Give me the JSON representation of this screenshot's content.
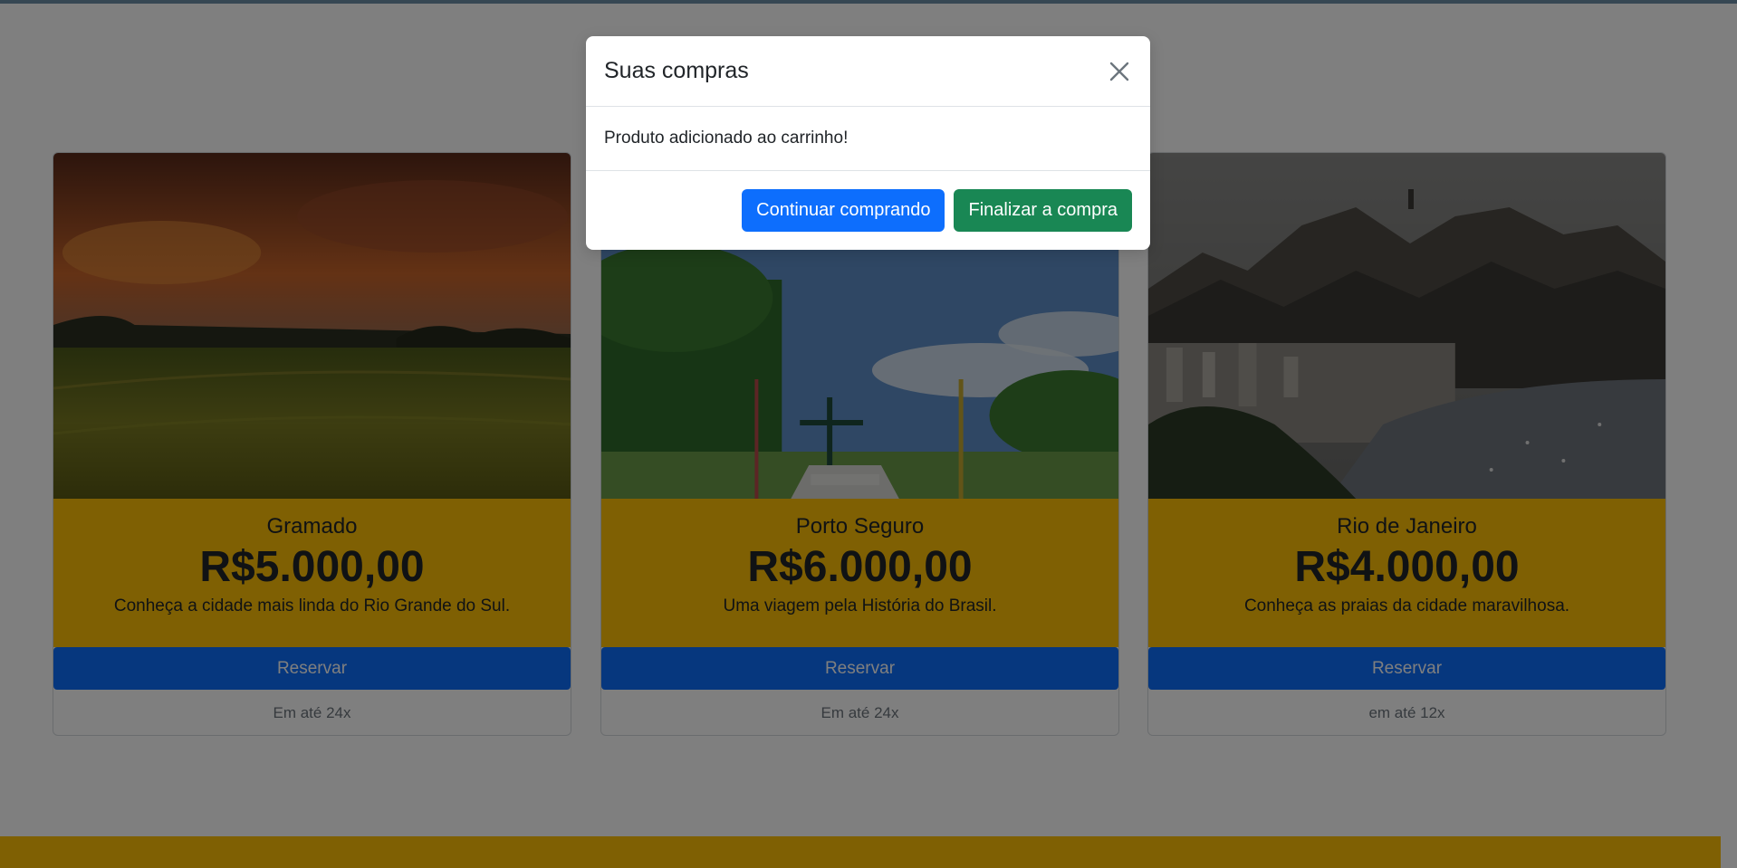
{
  "modal": {
    "title": "Suas compras",
    "message": "Produto adicionado ao carrinho!",
    "continue_label": "Continuar comprando",
    "checkout_label": "Finalizar a compra"
  },
  "cards": [
    {
      "title": "Gramado",
      "price": "R$5.000,00",
      "description": "Conheça a cidade mais linda do Rio Grande do Sul.",
      "button_label": "Reservar",
      "footer": "Em até 24x"
    },
    {
      "title": "Porto Seguro",
      "price": "R$6.000,00",
      "description": "Uma viagem pela História do Brasil.",
      "button_label": "Reservar",
      "footer": "Em até 24x"
    },
    {
      "title": "Rio de Janeiro",
      "price": "R$4.000,00",
      "description": "Conheça as praias da cidade maravilhosa.",
      "button_label": "Reservar",
      "footer": "em até 12x"
    }
  ],
  "colors": {
    "card_body": "#ffc107",
    "reserve_button": "#0d6efd",
    "continue_button": "#0d6efd",
    "checkout_button": "#198754"
  }
}
